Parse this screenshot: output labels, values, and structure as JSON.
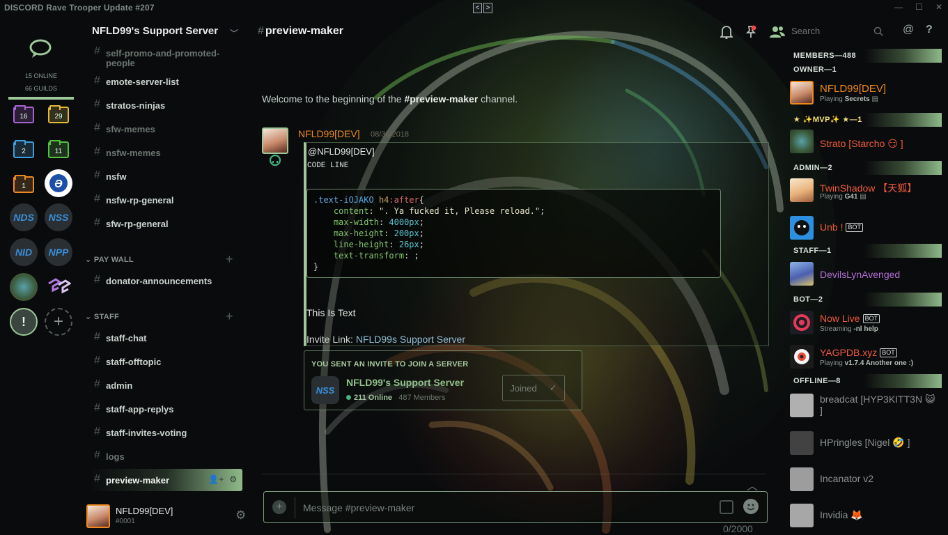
{
  "window": {
    "app_title": "DISCORD Rave Trooper Update #207",
    "nav_back": "<",
    "nav_forward": ">"
  },
  "guilds": {
    "online_count": "15 ONLINE",
    "guild_count": "66 GUILDS",
    "folders": [
      {
        "count": "16",
        "color": "#a763d6"
      },
      {
        "count": "29",
        "color": "#e3b935"
      },
      {
        "count": "2",
        "color": "#3aa0e0"
      },
      {
        "count": "11",
        "color": "#54c43f"
      },
      {
        "count": "1",
        "color": "#ee8a22"
      }
    ],
    "servers": [
      "NDS",
      "NSS",
      "NID",
      "NPP"
    ],
    "add_server": "+",
    "alert": "!"
  },
  "server": {
    "name": "NFLD99's Support Server"
  },
  "channels": {
    "top": [
      "self-promo-and-promoted-people",
      "emote-server-list",
      "stratos-ninjas",
      "sfw-memes",
      "nsfw-memes",
      "nsfw",
      "nsfw-rp-general",
      "sfw-rp-general"
    ],
    "category_paywall": "PAY WALL",
    "paywall": [
      "donator-announcements"
    ],
    "category_staff": "STAFF",
    "staff": [
      "staff-chat",
      "staff-offtopic",
      "admin",
      "staff-app-replys",
      "staff-invites-voting",
      "logs",
      "preview-maker"
    ]
  },
  "user_panel": {
    "name": "NFLD99[DEV]",
    "tag": "#0001"
  },
  "header": {
    "channel": "preview-maker",
    "search_placeholder": "Search"
  },
  "chat": {
    "welcome_prefix": "Welcome to the beginning of the ",
    "welcome_channel": "#preview-maker",
    "welcome_suffix": " channel.",
    "message": {
      "author": "NFLD99[DEV]",
      "timestamp": "08/30/2018",
      "mention": "@NFLD99[DEV]",
      "code_line": "CODE LINE",
      "code": {
        "selector": ".text-iOJAKO",
        "tag": "h4",
        "pseudo": ":after",
        "open": "{",
        "props": [
          {
            "name": "content",
            "value": "\". Ya fucked it, Please reload.\"",
            "kind": "str"
          },
          {
            "name": "max-width",
            "value": "4000px",
            "kind": "num"
          },
          {
            "name": "max-height",
            "value": "200px",
            "kind": "num"
          },
          {
            "name": "line-height",
            "value": "26px",
            "kind": "num"
          },
          {
            "name": "text-transform",
            "value": "",
            "kind": "str"
          }
        ],
        "close": "}"
      },
      "text": "This Is Text",
      "invite_label": "Invite Link: ",
      "invite_link": "NFLD99s Support Server"
    },
    "invite": {
      "label": "YOU SENT AN INVITE TO JOIN A SERVER",
      "server_name": "NFLD99's Support Server",
      "online": "211 Online",
      "members": "487 Members",
      "button": "Joined",
      "icon": "NSS"
    },
    "composer_placeholder": "Message #preview-maker",
    "counter": "0/2000"
  },
  "members": {
    "total_header": "MEMBERS—488",
    "groups": [
      {
        "title": "OWNER—1",
        "members": [
          {
            "name": "NFLD99[DEV]",
            "color": "#f08a1c",
            "activity_prefix": "Playing ",
            "activity": "Secrets"
          }
        ]
      },
      {
        "title": "★ ✨MVP✨ ★—1",
        "members": [
          {
            "name": "Strato [Starcho 😏 ]",
            "color": "#f05a3c",
            "activity_prefix": "",
            "activity": ""
          }
        ]
      },
      {
        "title": "ADMIN—2",
        "members": [
          {
            "name": "TwinShadow 【天狐】",
            "color": "#f05a3c",
            "activity_prefix": "Playing ",
            "activity": "G41"
          },
          {
            "name": "Unb !",
            "color": "#f05a3c",
            "activity_prefix": "",
            "activity": "",
            "bot": "BOT"
          }
        ]
      },
      {
        "title": "STAFF—1",
        "members": [
          {
            "name": "DevilsLynAvenged",
            "color": "#b26fd4",
            "activity_prefix": "",
            "activity": ""
          }
        ]
      },
      {
        "title": "BOT—2",
        "members": [
          {
            "name": "Now Live",
            "color": "#f05a3c",
            "activity_prefix": "Streaming ",
            "activity": "-nl help",
            "bot": "BOT"
          },
          {
            "name": "YAGPDB.xyz",
            "color": "#f05a3c",
            "activity_prefix": "Playing ",
            "activity": "v1.7.4 Another one :)",
            "bot": "BOT"
          }
        ]
      },
      {
        "title": "OFFLINE—8",
        "members": [
          {
            "name": "breadcat [HYP3KITT3N 😺 ]",
            "color": "#8b918d"
          },
          {
            "name": "HPringles [Nigel 🤣 ]",
            "color": "#8b918d"
          },
          {
            "name": "Incanator v2",
            "color": "#8b918d"
          },
          {
            "name": "Invidia 🦊",
            "color": "#8b918d"
          }
        ]
      }
    ]
  },
  "colors": {
    "accent": "#9ec79a",
    "author": "#f08a1c",
    "owner": "#f08a1c",
    "admin": "#f05a3c"
  }
}
